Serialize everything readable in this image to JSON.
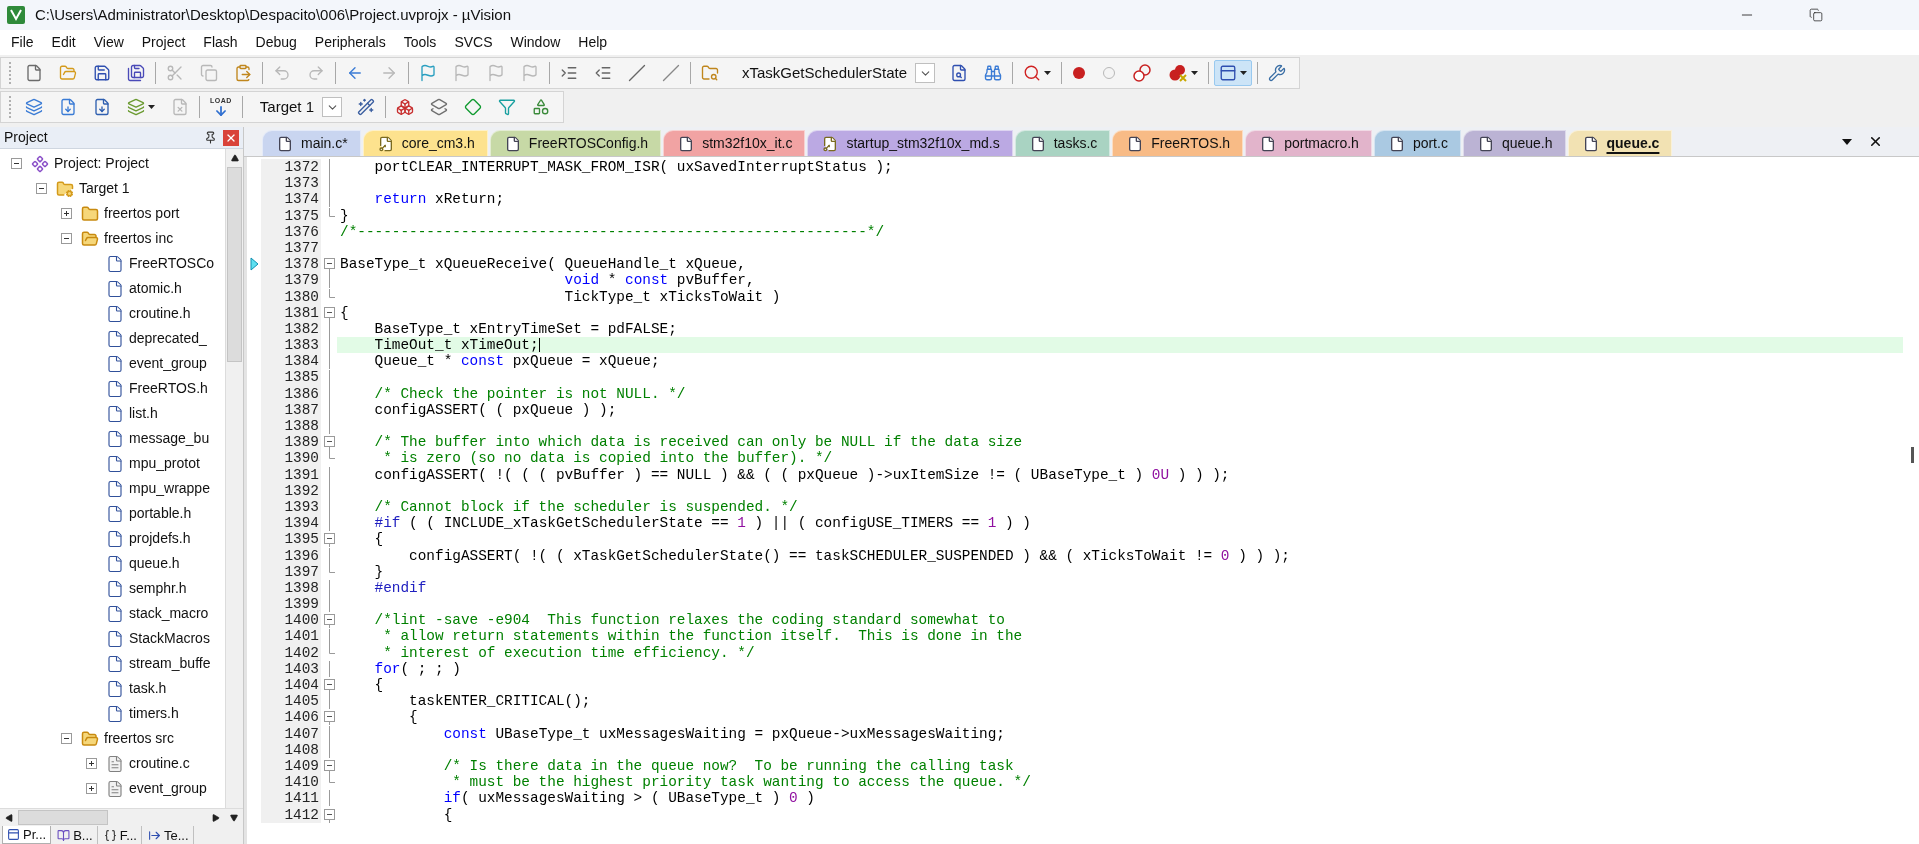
{
  "window": {
    "title": "C:\\Users\\Administrator\\Desktop\\Despacito\\006\\Project.uvprojx - µVision"
  },
  "menu": [
    "File",
    "Edit",
    "View",
    "Project",
    "Flash",
    "Debug",
    "Peripherals",
    "Tools",
    "SVCS",
    "Window",
    "Help"
  ],
  "toolbar_1": [
    [
      {
        "kind": "new",
        "disabled": false,
        "pressed": false,
        "dropdown": false
      },
      {
        "kind": "open",
        "disabled": false,
        "pressed": false,
        "dropdown": false
      },
      {
        "kind": "save",
        "disabled": false,
        "pressed": false,
        "dropdown": false
      },
      {
        "kind": "save-all",
        "disabled": false,
        "pressed": false,
        "dropdown": false
      }
    ],
    [
      {
        "kind": "cut",
        "disabled": true,
        "pressed": false,
        "dropdown": false
      },
      {
        "kind": "copy",
        "disabled": true,
        "pressed": false,
        "dropdown": false
      },
      {
        "kind": "paste",
        "disabled": false,
        "pressed": false,
        "dropdown": false
      }
    ],
    [
      {
        "kind": "undo",
        "disabled": true,
        "pressed": false,
        "dropdown": false
      },
      {
        "kind": "redo",
        "disabled": true,
        "pressed": false,
        "dropdown": false
      }
    ],
    [
      {
        "kind": "back",
        "disabled": false,
        "pressed": false,
        "dropdown": false
      },
      {
        "kind": "forward",
        "disabled": true,
        "pressed": false,
        "dropdown": false
      }
    ],
    [
      {
        "kind": "bookmark",
        "disabled": false,
        "pressed": false,
        "dropdown": false
      },
      {
        "kind": "prev-bookmark",
        "disabled": true,
        "pressed": false,
        "dropdown": false
      },
      {
        "kind": "next-bookmark",
        "disabled": true,
        "pressed": false,
        "dropdown": false
      },
      {
        "kind": "clear-bookmarks",
        "disabled": true,
        "pressed": false,
        "dropdown": false
      }
    ],
    [
      {
        "kind": "indent",
        "disabled": false,
        "pressed": false,
        "dropdown": false
      },
      {
        "kind": "unindent",
        "disabled": false,
        "pressed": false,
        "dropdown": false
      },
      {
        "kind": "comment",
        "disabled": false,
        "pressed": false,
        "dropdown": false
      },
      {
        "kind": "uncomment",
        "disabled": false,
        "pressed": false,
        "dropdown": false
      }
    ],
    [
      {
        "kind": "find-in-files",
        "disabled": false,
        "pressed": false,
        "dropdown": false
      },
      {
        "kind": "combo",
        "value": "xTaskGetSchedulerState",
        "disabled": false,
        "pressed": false,
        "dropdown": true
      },
      {
        "kind": "find",
        "disabled": false,
        "pressed": false,
        "dropdown": false
      },
      {
        "kind": "incremental-find",
        "disabled": false,
        "pressed": false,
        "dropdown": false
      }
    ],
    [
      {
        "kind": "debug",
        "disabled": false,
        "pressed": false,
        "dropdown": true
      }
    ],
    [
      {
        "kind": "breakpoint",
        "disabled": false,
        "pressed": false,
        "dropdown": false
      },
      {
        "kind": "disable-breakpoint",
        "disabled": false,
        "pressed": false,
        "dropdown": false
      },
      {
        "kind": "disable-all",
        "disabled": false,
        "pressed": false,
        "dropdown": false
      },
      {
        "kind": "kill-all",
        "disabled": false,
        "pressed": false,
        "dropdown": true
      }
    ],
    [
      {
        "kind": "window",
        "disabled": false,
        "pressed": true,
        "dropdown": true
      }
    ],
    [
      {
        "kind": "config",
        "disabled": false,
        "pressed": false,
        "dropdown": false
      }
    ]
  ],
  "toolbar_2": [
    [
      {
        "kind": "translate",
        "disabled": false,
        "pressed": false,
        "dropdown": false
      },
      {
        "kind": "build",
        "disabled": false,
        "pressed": false,
        "dropdown": false
      },
      {
        "kind": "rebuild",
        "disabled": false,
        "pressed": false,
        "dropdown": false
      },
      {
        "kind": "batch-build",
        "disabled": false,
        "pressed": false,
        "dropdown": true
      },
      {
        "kind": "stop-build",
        "disabled": true,
        "pressed": false,
        "dropdown": false
      }
    ],
    [
      {
        "kind": "load",
        "label": "LOAD",
        "disabled": false,
        "pressed": false,
        "dropdown": false
      }
    ],
    [
      {
        "kind": "combo",
        "value": "Target 1",
        "disabled": false,
        "pressed": false,
        "dropdown": true
      },
      {
        "kind": "options",
        "disabled": false,
        "pressed": false,
        "dropdown": false
      }
    ],
    [
      {
        "kind": "components",
        "disabled": false,
        "pressed": false,
        "dropdown": false
      },
      {
        "kind": "multi-project",
        "disabled": false,
        "pressed": false,
        "dropdown": false
      },
      {
        "kind": "diamond",
        "disabled": false,
        "pressed": false,
        "dropdown": false
      },
      {
        "kind": "funnel",
        "disabled": false,
        "pressed": false,
        "dropdown": false
      },
      {
        "kind": "packs",
        "disabled": false,
        "pressed": false,
        "dropdown": false
      }
    ]
  ],
  "project_panel": {
    "title": "Project",
    "tree": [
      {
        "label": "Project: Project",
        "kind": "project",
        "expanded": true,
        "children": [
          {
            "label": "Target 1",
            "kind": "target",
            "expanded": true,
            "children": [
              {
                "label": "freertos port",
                "kind": "folder",
                "expanded": false
              },
              {
                "label": "freertos inc",
                "kind": "folder",
                "expanded": true,
                "children": [
                  {
                    "label": "FreeRTOSCo",
                    "kind": "header"
                  },
                  {
                    "label": "atomic.h",
                    "kind": "header"
                  },
                  {
                    "label": "croutine.h",
                    "kind": "header"
                  },
                  {
                    "label": "deprecated_",
                    "kind": "header"
                  },
                  {
                    "label": "event_group",
                    "kind": "header"
                  },
                  {
                    "label": "FreeRTOS.h",
                    "kind": "header"
                  },
                  {
                    "label": "list.h",
                    "kind": "header"
                  },
                  {
                    "label": "message_bu",
                    "kind": "header"
                  },
                  {
                    "label": "mpu_protot",
                    "kind": "header"
                  },
                  {
                    "label": "mpu_wrappe",
                    "kind": "header"
                  },
                  {
                    "label": "portable.h",
                    "kind": "header"
                  },
                  {
                    "label": "projdefs.h",
                    "kind": "header"
                  },
                  {
                    "label": "queue.h",
                    "kind": "header"
                  },
                  {
                    "label": "semphr.h",
                    "kind": "header"
                  },
                  {
                    "label": "stack_macro",
                    "kind": "header"
                  },
                  {
                    "label": "StackMacros",
                    "kind": "header"
                  },
                  {
                    "label": "stream_buffe",
                    "kind": "header"
                  },
                  {
                    "label": "task.h",
                    "kind": "header"
                  },
                  {
                    "label": "timers.h",
                    "kind": "header"
                  }
                ]
              },
              {
                "label": "freertos src",
                "kind": "folder",
                "expanded": true,
                "children": [
                  {
                    "label": "croutine.c",
                    "kind": "source",
                    "expanded": false
                  },
                  {
                    "label": "event_group",
                    "kind": "source",
                    "expanded": false
                  }
                ]
              }
            ]
          }
        ]
      }
    ],
    "tabs": [
      {
        "label": "Pr...",
        "kind": "project",
        "selected": true
      },
      {
        "label": "B...",
        "kind": "books",
        "selected": false
      },
      {
        "label": "F...",
        "kind": "functions",
        "selected": false
      },
      {
        "label": "Te...",
        "kind": "templates",
        "selected": false
      }
    ]
  },
  "editor": {
    "tabs": [
      {
        "label": "main.c*",
        "kind": "file",
        "color": "#c9d5f0",
        "selected": false
      },
      {
        "label": "core_cm3.h",
        "kind": "key",
        "color": "#fde28e",
        "selected": false
      },
      {
        "label": "FreeRTOSConfig.h",
        "kind": "file",
        "color": "#c7d9a6",
        "selected": false
      },
      {
        "label": "stm32f10x_it.c",
        "kind": "file",
        "color": "#f1a3a3",
        "selected": false
      },
      {
        "label": "startup_stm32f10x_md.s",
        "kind": "key",
        "color": "#bba9e3",
        "selected": false
      },
      {
        "label": "tasks.c",
        "kind": "file",
        "color": "#a9d3c2",
        "selected": false
      },
      {
        "label": "FreeRTOS.h",
        "kind": "file",
        "color": "#f8bb86",
        "selected": false
      },
      {
        "label": "portmacro.h",
        "kind": "file",
        "color": "#e2b4cb",
        "selected": false
      },
      {
        "label": "port.c",
        "kind": "file",
        "color": "#aac9e2",
        "selected": false
      },
      {
        "label": "queue.h",
        "kind": "file",
        "color": "#bbb3d4",
        "selected": false
      },
      {
        "label": "queue.c",
        "kind": "file",
        "color": "#f2e2b3",
        "selected": true
      }
    ],
    "lines": [
      {
        "number": "1372",
        "kind": "line",
        "marker": false,
        "current": false,
        "segments": [
          {
            "kind": "code",
            "text": "    portCLEAR_INTERRUPT_MASK_FROM_ISR( uxSavedInterruptStatus );"
          }
        ]
      },
      {
        "number": "1373",
        "kind": "line",
        "marker": false,
        "current": false
      },
      {
        "number": "1374",
        "kind": "line",
        "marker": false,
        "current": false,
        "segments": [
          {
            "kind": "keyword",
            "text": "    return"
          },
          {
            "kind": "code",
            "text": " xReturn;"
          }
        ]
      },
      {
        "number": "1375",
        "kind": "end",
        "marker": false,
        "current": false,
        "segments": [
          {
            "kind": "code",
            "text": "}"
          }
        ]
      },
      {
        "number": "1376",
        "kind": "none",
        "marker": false,
        "current": false,
        "segments": [
          {
            "kind": "comment",
            "text": "/*-----------------------------------------------------------*/"
          }
        ]
      },
      {
        "number": "1377",
        "kind": "none",
        "marker": false,
        "current": false
      },
      {
        "number": "1378",
        "kind": "open",
        "marker": true,
        "current": false,
        "segments": [
          {
            "kind": "code",
            "text": "BaseType_t xQueueReceive( QueueHandle_t xQueue,"
          }
        ]
      },
      {
        "number": "1379",
        "kind": "line",
        "marker": false,
        "current": false,
        "segments": [
          {
            "kind": "keyword",
            "text": "                          void"
          },
          {
            "kind": "code",
            "text": " * "
          },
          {
            "kind": "keyword",
            "text": "const"
          },
          {
            "kind": "code",
            "text": " pvBuffer,"
          }
        ]
      },
      {
        "number": "1380",
        "kind": "end",
        "marker": false,
        "current": false,
        "segments": [
          {
            "kind": "code",
            "text": "                          TickType_t xTicksToWait )"
          }
        ]
      },
      {
        "number": "1381",
        "kind": "open",
        "marker": false,
        "current": false,
        "segments": [
          {
            "kind": "code",
            "text": "{"
          }
        ]
      },
      {
        "number": "1382",
        "kind": "line",
        "marker": false,
        "current": false,
        "segments": [
          {
            "kind": "code",
            "text": "    BaseType_t xEntryTimeSet = pdFALSE;"
          }
        ]
      },
      {
        "number": "1383",
        "kind": "line",
        "marker": false,
        "current": true,
        "segments": [
          {
            "kind": "code",
            "text": "    TimeOut_t xTimeOut;"
          }
        ]
      },
      {
        "number": "1384",
        "kind": "line",
        "marker": false,
        "current": false,
        "segments": [
          {
            "kind": "code",
            "text": "    Queue_t * "
          },
          {
            "kind": "keyword",
            "text": "const"
          },
          {
            "kind": "code",
            "text": " pxQueue = xQueue;"
          }
        ]
      },
      {
        "number": "1385",
        "kind": "line",
        "marker": false,
        "current": false
      },
      {
        "number": "1386",
        "kind": "line",
        "marker": false,
        "current": false,
        "segments": [
          {
            "kind": "comment",
            "text": "    /* Check the pointer is not NULL. */"
          }
        ]
      },
      {
        "number": "1387",
        "kind": "line",
        "marker": false,
        "current": false,
        "segments": [
          {
            "kind": "code",
            "text": "    configASSERT( ( pxQueue ) );"
          }
        ]
      },
      {
        "number": "1388",
        "kind": "line",
        "marker": false,
        "current": false
      },
      {
        "number": "1389",
        "kind": "open",
        "marker": false,
        "current": false,
        "segments": [
          {
            "kind": "comment",
            "text": "    /* The buffer into which data is received can only be NULL if the data size"
          }
        ]
      },
      {
        "number": "1390",
        "kind": "end",
        "marker": false,
        "current": false,
        "segments": [
          {
            "kind": "comment",
            "text": "     * is zero (so no data is copied into the buffer). */"
          }
        ]
      },
      {
        "number": "1391",
        "kind": "line",
        "marker": false,
        "current": false,
        "segments": [
          {
            "kind": "code",
            "text": "    configASSERT( !( ( ( pvBuffer ) == NULL ) && ( ( pxQueue )->uxItemSize != ( UBaseType_t ) "
          },
          {
            "kind": "number",
            "text": "0U"
          },
          {
            "kind": "code",
            "text": " ) ) );"
          }
        ]
      },
      {
        "number": "1392",
        "kind": "line",
        "marker": false,
        "current": false
      },
      {
        "number": "1393",
        "kind": "line",
        "marker": false,
        "current": false,
        "segments": [
          {
            "kind": "comment",
            "text": "    /* Cannot block if the scheduler is suspended. */"
          }
        ]
      },
      {
        "number": "1394",
        "kind": "line",
        "marker": false,
        "current": false,
        "segments": [
          {
            "kind": "preprocessor",
            "text": "    #if"
          },
          {
            "kind": "code",
            "text": " ( ( INCLUDE_xTaskGetSchedulerState == "
          },
          {
            "kind": "number",
            "text": "1"
          },
          {
            "kind": "code",
            "text": " ) || ( configUSE_TIMERS == "
          },
          {
            "kind": "number",
            "text": "1"
          },
          {
            "kind": "code",
            "text": " ) )"
          }
        ]
      },
      {
        "number": "1395",
        "kind": "open",
        "marker": false,
        "current": false,
        "segments": [
          {
            "kind": "code",
            "text": "    {"
          }
        ]
      },
      {
        "number": "1396",
        "kind": "line",
        "marker": false,
        "current": false,
        "segments": [
          {
            "kind": "code",
            "text": "        configASSERT( !( ( xTaskGetSchedulerState() == taskSCHEDULER_SUSPENDED ) && ( xTicksToWait != "
          },
          {
            "kind": "number",
            "text": "0"
          },
          {
            "kind": "code",
            "text": " ) ) );"
          }
        ]
      },
      {
        "number": "1397",
        "kind": "end",
        "marker": false,
        "current": false,
        "segments": [
          {
            "kind": "code",
            "text": "    }"
          }
        ]
      },
      {
        "number": "1398",
        "kind": "line",
        "marker": false,
        "current": false,
        "segments": [
          {
            "kind": "preprocessor",
            "text": "    #endif"
          }
        ]
      },
      {
        "number": "1399",
        "kind": "line",
        "marker": false,
        "current": false
      },
      {
        "number": "1400",
        "kind": "open",
        "marker": false,
        "current": false,
        "segments": [
          {
            "kind": "comment",
            "text": "    /*lint -save -e904  This function relaxes the coding standard somewhat to"
          }
        ]
      },
      {
        "number": "1401",
        "kind": "line",
        "marker": false,
        "current": false,
        "segments": [
          {
            "kind": "comment",
            "text": "     * allow return statements within the function itself.  This is done in the"
          }
        ]
      },
      {
        "number": "1402",
        "kind": "end",
        "marker": false,
        "current": false,
        "segments": [
          {
            "kind": "comment",
            "text": "     * interest of execution time efficiency. */"
          }
        ]
      },
      {
        "number": "1403",
        "kind": "line",
        "marker": false,
        "current": false,
        "segments": [
          {
            "kind": "keyword",
            "text": "    for"
          },
          {
            "kind": "code",
            "text": "( ; ; )"
          }
        ]
      },
      {
        "number": "1404",
        "kind": "open",
        "marker": false,
        "current": false,
        "segments": [
          {
            "kind": "code",
            "text": "    {"
          }
        ]
      },
      {
        "number": "1405",
        "kind": "line",
        "marker": false,
        "current": false,
        "segments": [
          {
            "kind": "code",
            "text": "        taskENTER_CRITICAL();"
          }
        ]
      },
      {
        "number": "1406",
        "kind": "open",
        "marker": false,
        "current": false,
        "segments": [
          {
            "kind": "code",
            "text": "        {"
          }
        ]
      },
      {
        "number": "1407",
        "kind": "line",
        "marker": false,
        "current": false,
        "segments": [
          {
            "kind": "keyword",
            "text": "            const"
          },
          {
            "kind": "code",
            "text": " UBaseType_t uxMessagesWaiting = pxQueue->uxMessagesWaiting;"
          }
        ]
      },
      {
        "number": "1408",
        "kind": "line",
        "marker": false,
        "current": false
      },
      {
        "number": "1409",
        "kind": "open",
        "marker": false,
        "current": false,
        "segments": [
          {
            "kind": "comment",
            "text": "            /* Is there data in the queue now?  To be running the calling task"
          }
        ]
      },
      {
        "number": "1410",
        "kind": "end",
        "marker": false,
        "current": false,
        "segments": [
          {
            "kind": "comment",
            "text": "             * must be the highest priority task wanting to access the queue. */"
          }
        ]
      },
      {
        "number": "1411",
        "kind": "line",
        "marker": false,
        "current": false,
        "segments": [
          {
            "kind": "keyword",
            "text": "            if"
          },
          {
            "kind": "code",
            "text": "( uxMessagesWaiting > ( UBaseType_t ) "
          },
          {
            "kind": "number",
            "text": "0"
          },
          {
            "kind": "code",
            "text": " )"
          }
        ]
      },
      {
        "number": "1412",
        "kind": "open",
        "marker": false,
        "current": false,
        "segments": [
          {
            "kind": "code",
            "text": "            {"
          }
        ]
      }
    ]
  }
}
